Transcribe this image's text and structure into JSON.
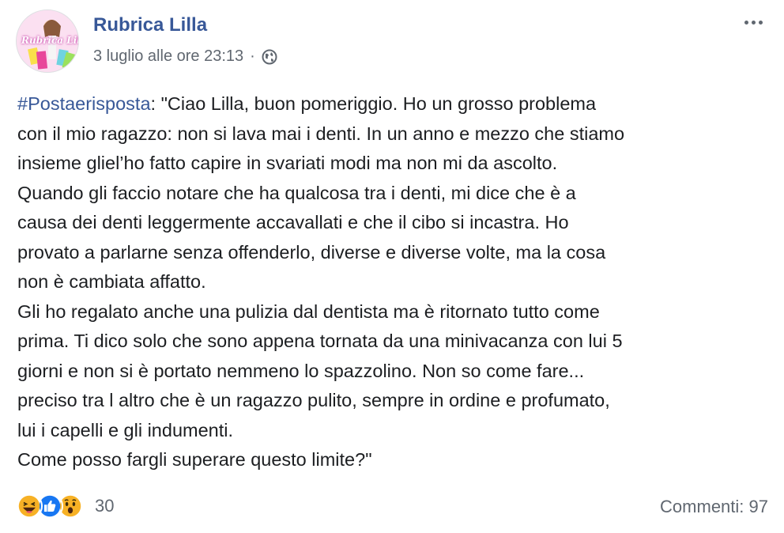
{
  "post": {
    "author": "Rubrica Lilla",
    "avatar_text": "Rubrica Lilla",
    "timestamp": "3 luglio alle ore 23:13",
    "separator": "·",
    "audience_icon": "globe-icon",
    "more_icon": "more-options-icon",
    "hashtag": "#Postaerisposta",
    "body": ": \"Ciao Lilla, buon pomeriggio. Ho un grosso problema\ncon il mio ragazzo: non si lava mai i denti. In un anno e mezzo che stiamo\ninsieme gliel’ho fatto capire in svariati modi ma non mi da ascolto.\nQuando gli faccio notare che ha qualcosa tra i denti, mi dice che è a\ncausa dei denti leggermente accavallati e che il cibo si incastra. Ho\nprovato a parlarne senza offenderlo, diverse e diverse volte, ma la cosa\nnon è cambiata affatto.\nGli ho regalato anche una pulizia dal dentista ma è ritornato tutto come\nprima. Ti dico solo che sono appena tornata da una minivacanza con lui 5\ngiorni e non si è portato nemmeno lo spazzolino. Non so come fare...\npreciso tra l altro che è un ragazzo pulito, sempre in ordine e profumato,\nlui i capelli e gli indumenti.\nCome posso fargli superare questo limite?\""
  },
  "footer": {
    "reactions": [
      "haha-reaction-icon",
      "like-reaction-icon",
      "wow-reaction-icon"
    ],
    "reaction_count": "30",
    "comments": "Commenti: 97"
  },
  "colors": {
    "link": "#385898",
    "secondary_text": "#606770",
    "like_blue": "#1877f2",
    "emoji_yellow": "#f7b125"
  }
}
